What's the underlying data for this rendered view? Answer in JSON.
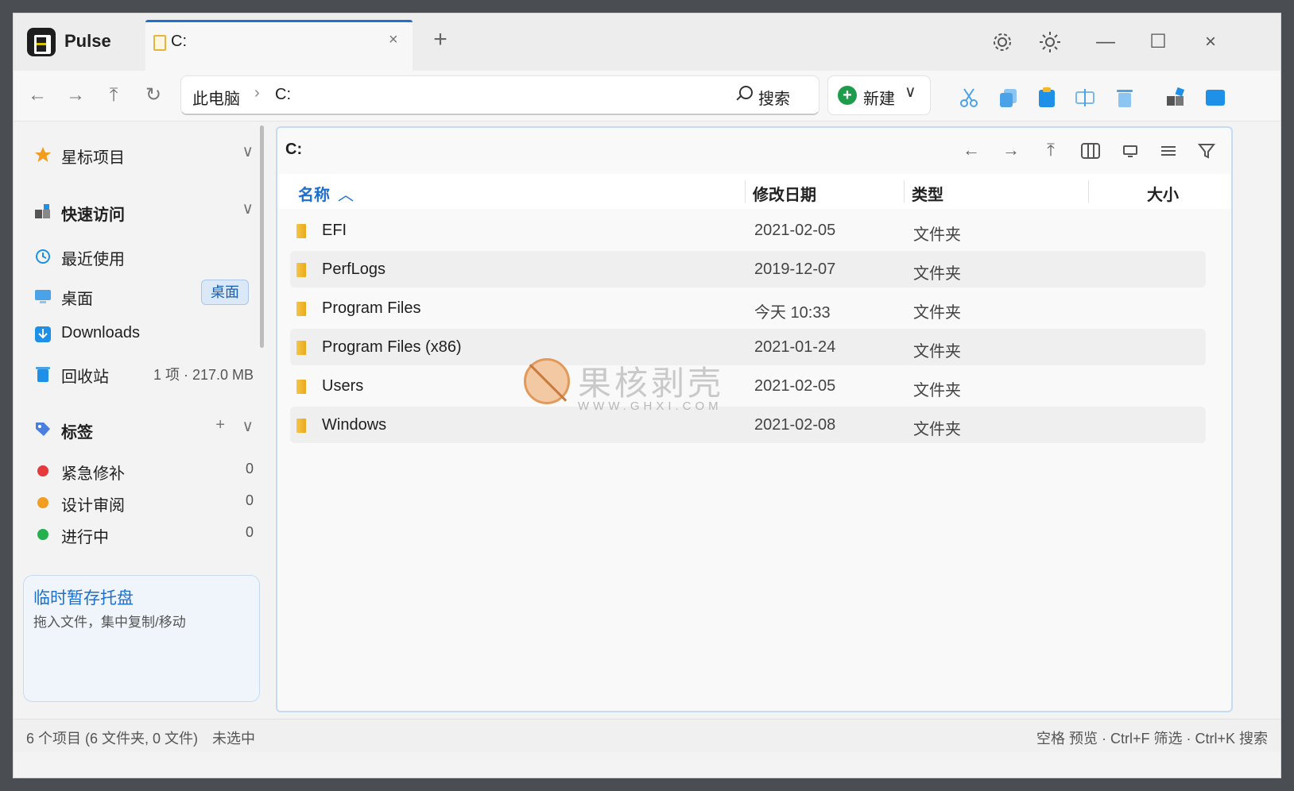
{
  "app": {
    "name": "Pulse"
  },
  "tab": {
    "title": "C:",
    "close": "×"
  },
  "newtab": "+",
  "window_controls": {
    "minimize": "—",
    "maximize": "☐",
    "close": "×"
  },
  "navbar": {
    "breadcrumbs": [
      "此电脑",
      "C:"
    ],
    "separator": "›",
    "search_label": "搜索",
    "new_label": "新建",
    "new_chevron": "∨"
  },
  "sidebar": {
    "favorites": {
      "label": "星标项目",
      "chevron": "∨"
    },
    "quick_access": {
      "label": "快速访问",
      "chevron": "∨"
    },
    "items": [
      {
        "label": "最近使用",
        "icon": "clock-icon"
      },
      {
        "label": "桌面",
        "badge": "桌面",
        "icon": "desktop-icon"
      },
      {
        "label": "Downloads",
        "icon": "downloads-icon"
      },
      {
        "label": "回收站",
        "info": "1 项 · 217.0 MB",
        "icon": "recycle-bin-icon"
      }
    ],
    "tags": {
      "label": "标签",
      "add": "+",
      "chevron": "∨",
      "items": [
        {
          "label": "紧急修补",
          "count": "0",
          "color": "#e5393c"
        },
        {
          "label": "设计审阅",
          "count": "0",
          "color": "#f29d1f"
        },
        {
          "label": "进行中",
          "count": "0",
          "color": "#22b14c"
        }
      ]
    },
    "tray": {
      "title": "临时暂存托盘",
      "subtitle": "拖入文件，集中复制/移动"
    }
  },
  "panel": {
    "path": "C:",
    "columns": {
      "name": "名称",
      "name_sort": "︿",
      "date": "修改日期",
      "type": "类型",
      "size": "大小"
    },
    "rows": [
      {
        "name": "EFI",
        "date": "2021-02-05",
        "type": "文件夹"
      },
      {
        "name": "PerfLogs",
        "date": "2019-12-07",
        "type": "文件夹"
      },
      {
        "name": "Program Files",
        "date": "今天 10:33",
        "type": "文件夹"
      },
      {
        "name": "Program Files (x86)",
        "date": "2021-01-24",
        "type": "文件夹"
      },
      {
        "name": "Users",
        "date": "2021-02-05",
        "type": "文件夹"
      },
      {
        "name": "Windows",
        "date": "2021-02-08",
        "type": "文件夹"
      }
    ]
  },
  "watermark": {
    "cn": "果核剥壳",
    "en": "WWW.GHXI.COM"
  },
  "statusbar": {
    "summary": "6 个项目 (6 文件夹, 0 文件)",
    "selection": "未选中",
    "shortcuts": "空格 预览 · Ctrl+F 筛选 · Ctrl+K 搜索"
  },
  "colors": {
    "accent": "#1f6fd6",
    "new_button": "#1d9d4b"
  }
}
